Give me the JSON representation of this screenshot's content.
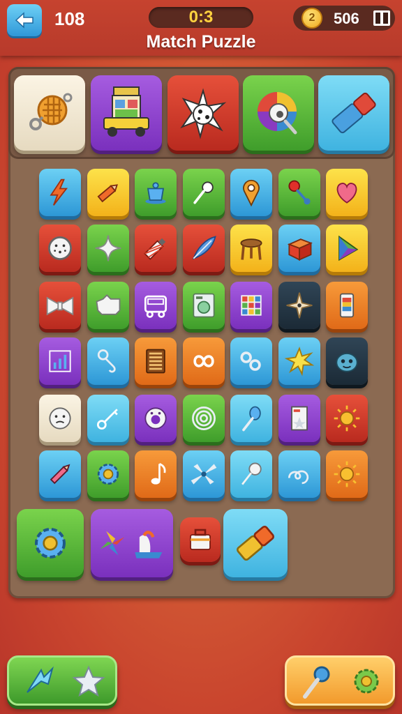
{
  "header": {
    "level": "108",
    "timer": "0:3",
    "title": "Match Puzzle",
    "coin_symbol": "2",
    "coins": "506"
  },
  "colors": {
    "accent_gold": "#ffd23f",
    "header_red": "#c6432f",
    "board_brown": "#8b6a52"
  },
  "tray": {
    "tiles": [
      {
        "icon": "waffle-keychain-icon",
        "color": "cream"
      },
      {
        "icon": "cart-icon",
        "color": "purple"
      },
      {
        "icon": "spiky-ball-icon",
        "color": "red"
      },
      {
        "icon": "rainbow-shell-icon",
        "color": "green"
      },
      {
        "icon": "eraser-icon",
        "color": "sky"
      }
    ]
  },
  "board": {
    "rows": [
      [
        {
          "icon": "lightning-icon",
          "color": "blue"
        },
        {
          "icon": "pencil-icon",
          "color": "yellow"
        },
        {
          "icon": "teacup-icon",
          "color": "green"
        },
        {
          "icon": "magnifier-icon",
          "color": "green"
        },
        {
          "icon": "location-pin-icon",
          "color": "blue"
        },
        {
          "icon": "joystick-icon",
          "color": "green"
        },
        {
          "icon": "heart-icon",
          "color": "yellow"
        }
      ],
      [
        {
          "icon": "clock-icon",
          "color": "red"
        },
        {
          "icon": "sparkle-icon",
          "color": "green"
        },
        {
          "icon": "paint-brush-icon",
          "color": "red"
        },
        {
          "icon": "feather-icon",
          "color": "red"
        },
        {
          "icon": "stool-icon",
          "color": "yellow"
        },
        {
          "icon": "box-icon",
          "color": "blue"
        },
        {
          "icon": "triangle-icon",
          "color": "yellow"
        }
      ],
      [
        {
          "icon": "bowtie-icon",
          "color": "red"
        },
        {
          "icon": "cow-icon",
          "color": "green"
        },
        {
          "icon": "bus-icon",
          "color": "purple"
        },
        {
          "icon": "washing-machine-icon",
          "color": "green"
        },
        {
          "icon": "grid-icon",
          "color": "purple"
        },
        {
          "icon": "star-shuriken-icon",
          "color": "navy"
        },
        {
          "icon": "phone-icon",
          "color": "orange"
        }
      ],
      [
        {
          "icon": "bar-chart-icon",
          "color": "purple"
        },
        {
          "icon": "hook-icon",
          "color": "blue"
        },
        {
          "icon": "abacus-icon",
          "color": "orange"
        },
        {
          "icon": "infinity-icon",
          "color": "orange"
        },
        {
          "icon": "link-icon",
          "color": "blue"
        },
        {
          "icon": "starburst-icon",
          "color": "blue"
        },
        {
          "icon": "monster-face-icon",
          "color": "navy"
        }
      ],
      [
        {
          "icon": "smiley-face-icon",
          "color": "cream"
        },
        {
          "icon": "key-icon",
          "color": "sky"
        },
        {
          "icon": "donut-icon",
          "color": "purple"
        },
        {
          "icon": "target-icon",
          "color": "green"
        },
        {
          "icon": "spoon-icon",
          "color": "sky"
        },
        {
          "icon": "card-icon",
          "color": "purple"
        },
        {
          "icon": "sun-icon",
          "color": "red"
        }
      ],
      [
        {
          "icon": "pen-icon",
          "color": "blue"
        },
        {
          "icon": "gear-icon",
          "color": "green"
        },
        {
          "icon": "music-note-icon",
          "color": "orange"
        },
        {
          "icon": "propeller-icon",
          "color": "blue"
        },
        {
          "icon": "pin-icon",
          "color": "sky"
        },
        {
          "icon": "swirl-icon",
          "color": "blue"
        },
        {
          "icon": "sun-icon",
          "color": "orange"
        }
      ]
    ],
    "extra": [
      {
        "icon": "gear-icon",
        "color": "green"
      },
      {
        "icon": "pinwheel-ship-icon",
        "color": "purple"
      },
      {
        "icon": "toolbox-icon",
        "color": "red"
      },
      {
        "icon": "eraser-icon",
        "color": "sky"
      }
    ]
  },
  "powerups": {
    "left": [
      "arrow-icon",
      "star-icon"
    ],
    "right": [
      "magnifier-icon",
      "gear-icon"
    ]
  }
}
